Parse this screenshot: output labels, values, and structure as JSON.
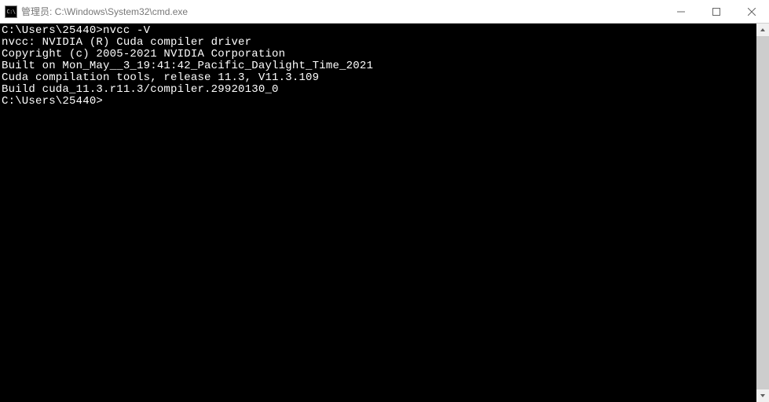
{
  "titlebar": {
    "icon_text": "C:\\",
    "title": "管理员: C:\\Windows\\System32\\cmd.exe"
  },
  "terminal": {
    "lines": [
      "",
      "C:\\Users\\25440>nvcc -V",
      "nvcc: NVIDIA (R) Cuda compiler driver",
      "Copyright (c) 2005-2021 NVIDIA Corporation",
      "Built on Mon_May__3_19:41:42_Pacific_Daylight_Time_2021",
      "Cuda compilation tools, release 11.3, V11.3.109",
      "Build cuda_11.3.r11.3/compiler.29920130_0",
      "",
      "C:\\Users\\25440>"
    ]
  }
}
